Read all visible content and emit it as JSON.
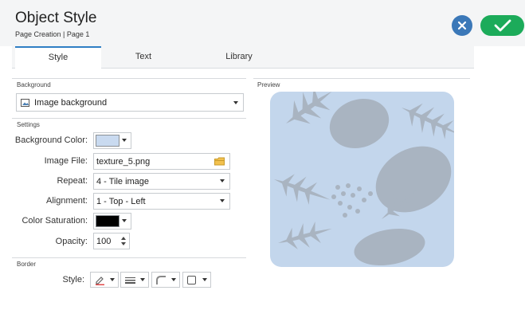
{
  "header": {
    "title": "Object Style",
    "subtitle": "Page Creation | Page 1"
  },
  "tabs": [
    {
      "label": "Style"
    },
    {
      "label": "Text"
    },
    {
      "label": "Library"
    }
  ],
  "sections": {
    "background": "Background",
    "settings": "Settings",
    "border": "Border",
    "preview": "Preview"
  },
  "background": {
    "type": "Image background"
  },
  "settings": {
    "background_color": {
      "label": "Background Color:",
      "color": "#c9daf0"
    },
    "image_file": {
      "label": "Image File:",
      "value": "texture_5.png"
    },
    "repeat": {
      "label": "Repeat:",
      "value": "4 - Tile image"
    },
    "alignment": {
      "label": "Alignment:",
      "value": "1 - Top - Left"
    },
    "color_saturation": {
      "label": "Color Saturation:",
      "color": "#000000"
    },
    "opacity": {
      "label": "Opacity:",
      "value": "100"
    }
  },
  "border": {
    "style_label": "Style:"
  },
  "colors": {
    "accent": "#2f7fc4",
    "ok": "#1cab5a",
    "close": "#3b78b8",
    "preview_bg": "#c3d6ec",
    "leaf": "#a9b4c1"
  },
  "icons": [
    "close-icon",
    "checkmark-icon",
    "image-icon",
    "folder-icon",
    "pen-icon",
    "line-weight-icon",
    "corner-icon",
    "square-icon"
  ]
}
